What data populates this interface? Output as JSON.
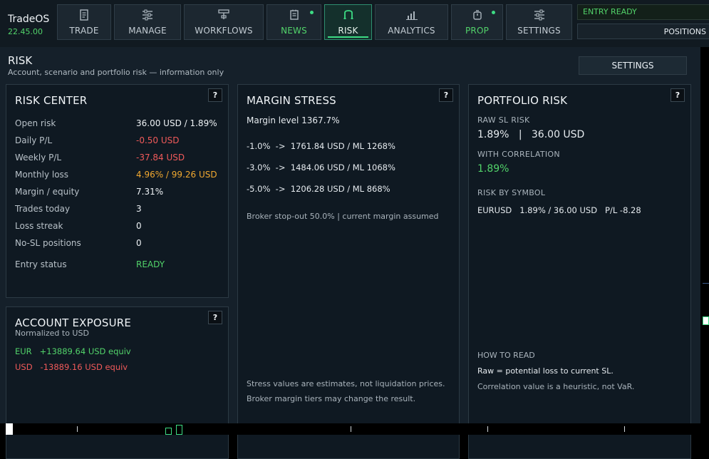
{
  "brand": {
    "name": "TradeOS",
    "version": "22.45.00"
  },
  "tabs": [
    {
      "label": "TRADE"
    },
    {
      "label": "MANAGE"
    },
    {
      "label": "WORKFLOWS"
    },
    {
      "label": "NEWS"
    },
    {
      "label": "RISK"
    },
    {
      "label": "ANALYTICS"
    },
    {
      "label": "PROP"
    },
    {
      "label": "SETTINGS"
    }
  ],
  "status": {
    "entry": "ENTRY READY",
    "positions": "POSITIONS"
  },
  "panel": {
    "title": "RISK",
    "subtitle": "Account, scenario and portfolio risk — information only",
    "settings_label": "SETTINGS",
    "help_label": "?"
  },
  "risk_center": {
    "title": "RISK CENTER",
    "rows": [
      {
        "label": "Open risk",
        "value": "36.00 USD / 1.89%"
      },
      {
        "label": "Daily P/L",
        "value": "-0.50 USD"
      },
      {
        "label": "Weekly P/L",
        "value": "-37.84 USD"
      },
      {
        "label": "Monthly loss",
        "value": "4.96% / 99.26 USD"
      },
      {
        "label": "Margin / equity",
        "value": "7.31%"
      },
      {
        "label": "Trades today",
        "value": "3"
      },
      {
        "label": "Loss streak",
        "value": "0"
      },
      {
        "label": "No-SL positions",
        "value": "0"
      },
      {
        "label": "Entry status",
        "value": "READY"
      }
    ]
  },
  "account_exposure": {
    "title": "ACCOUNT EXPOSURE",
    "subtitle": "Normalized to USD",
    "items": [
      {
        "currency": "EUR",
        "amount": "+13889.64 USD equiv"
      },
      {
        "currency": "USD",
        "amount": "-13889.16 USD equiv"
      }
    ]
  },
  "margin_stress": {
    "title": "MARGIN STRESS",
    "level": "Margin level 1367.7%",
    "scenarios": [
      "-1.0%  ->  1761.84 USD / ML 1268%",
      "-3.0%  ->  1484.06 USD / ML 1068%",
      "-5.0%  ->  1206.28 USD / ML 868%"
    ],
    "broker_note": "Broker stop-out 50.0% | current margin assumed",
    "footnotes": [
      "Stress values are estimates, not liquidation prices.",
      "Broker margin tiers may change the result."
    ]
  },
  "portfolio_risk": {
    "title": "PORTFOLIO RISK",
    "raw_caption": "RAW SL RISK",
    "raw_value": "1.89%   |   36.00 USD",
    "corr_caption": "WITH CORRELATION",
    "corr_value": "1.89%",
    "symbol_caption": "RISK BY SYMBOL",
    "symbol_row": "EURUSD   1.89% / 36.00 USD   P/L -8.28",
    "how_caption": "HOW TO READ",
    "how_line1": "Raw = potential loss to current SL.",
    "how_line2": "Correlation value is a heuristic, not VaR."
  },
  "colors": {
    "accent": "#3ddc84",
    "negative": "#f05a5a",
    "warning": "#f0a830",
    "panel": "#15202a"
  }
}
